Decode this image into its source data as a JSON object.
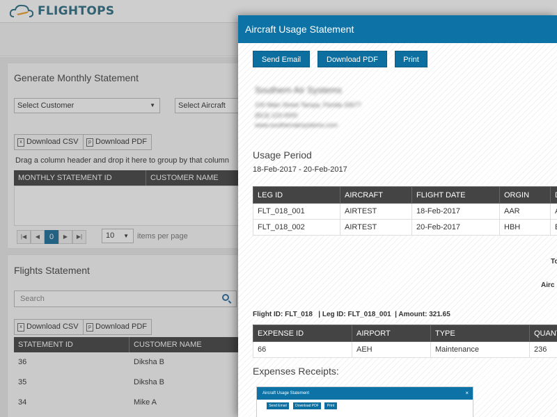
{
  "app": {
    "logo_text": "FLIGHTOPS"
  },
  "monthly": {
    "title": "Generate Monthly Statement",
    "select_customer": "Select Customer",
    "select_aircraft": "Select Aircraft",
    "download_csv": "Download CSV",
    "download_pdf": "Download PDF",
    "drag_hint": "Drag a column header and drop it here to group by that column",
    "columns": [
      "MONTHLY STATEMENT ID",
      "CUSTOMER NAME"
    ],
    "pager": {
      "page": "0",
      "per_page_value": "10",
      "per_page_label": "items per page"
    }
  },
  "flights": {
    "title": "Flights Statement",
    "search_placeholder": "Search",
    "download_csv": "Download CSV",
    "download_pdf": "Download PDF",
    "columns": [
      "STATEMENT ID",
      "CUSTOMER NAME"
    ],
    "rows": [
      {
        "id": "36",
        "name": "Diksha B"
      },
      {
        "id": "35",
        "name": "Diksha B"
      },
      {
        "id": "34",
        "name": "Mike A"
      }
    ]
  },
  "modal": {
    "title": "Aircraft Usage Statement",
    "buttons": {
      "send_email": "Send Email",
      "download_pdf": "Download PDF",
      "print": "Print"
    },
    "company": {
      "name": "Southern Air Systems",
      "address": "100 Main Street Tampa, Florida 33677",
      "phone": "(813) 123-0000",
      "website": "www.southernairsystems.com"
    },
    "usage_period_title": "Usage Period",
    "usage_period": "18-Feb-2017 - 20-Feb-2017",
    "legs_columns": [
      "LEG ID",
      "AIRCRAFT",
      "FLIGHT DATE",
      "ORGIN",
      "D"
    ],
    "legs": [
      [
        "FLT_018_001",
        "AIRTEST",
        "18-Feb-2017",
        "AAR",
        "A"
      ],
      [
        "FLT_018_002",
        "AIRTEST",
        "20-Feb-2017",
        "HBH",
        "E"
      ]
    ],
    "right_cut_1": "To",
    "right_cut_2": "Airc",
    "flight_info": "Flight ID: FLT_018   | Leg ID: FLT_018_001  | Amount: 321.65",
    "expense_columns": [
      "EXPENSE ID",
      "AIRPORT",
      "TYPE",
      "QUANT"
    ],
    "expenses": [
      [
        "66",
        "AEH",
        "Maintenance",
        "236"
      ]
    ],
    "receipts_title": "Expenses Receipts:",
    "receipt_thumb": {
      "title": "Aircraft Usage Statement",
      "close": "×",
      "send_email": "Send Email",
      "download_pdf": "Download PDF",
      "print": "Print"
    }
  }
}
